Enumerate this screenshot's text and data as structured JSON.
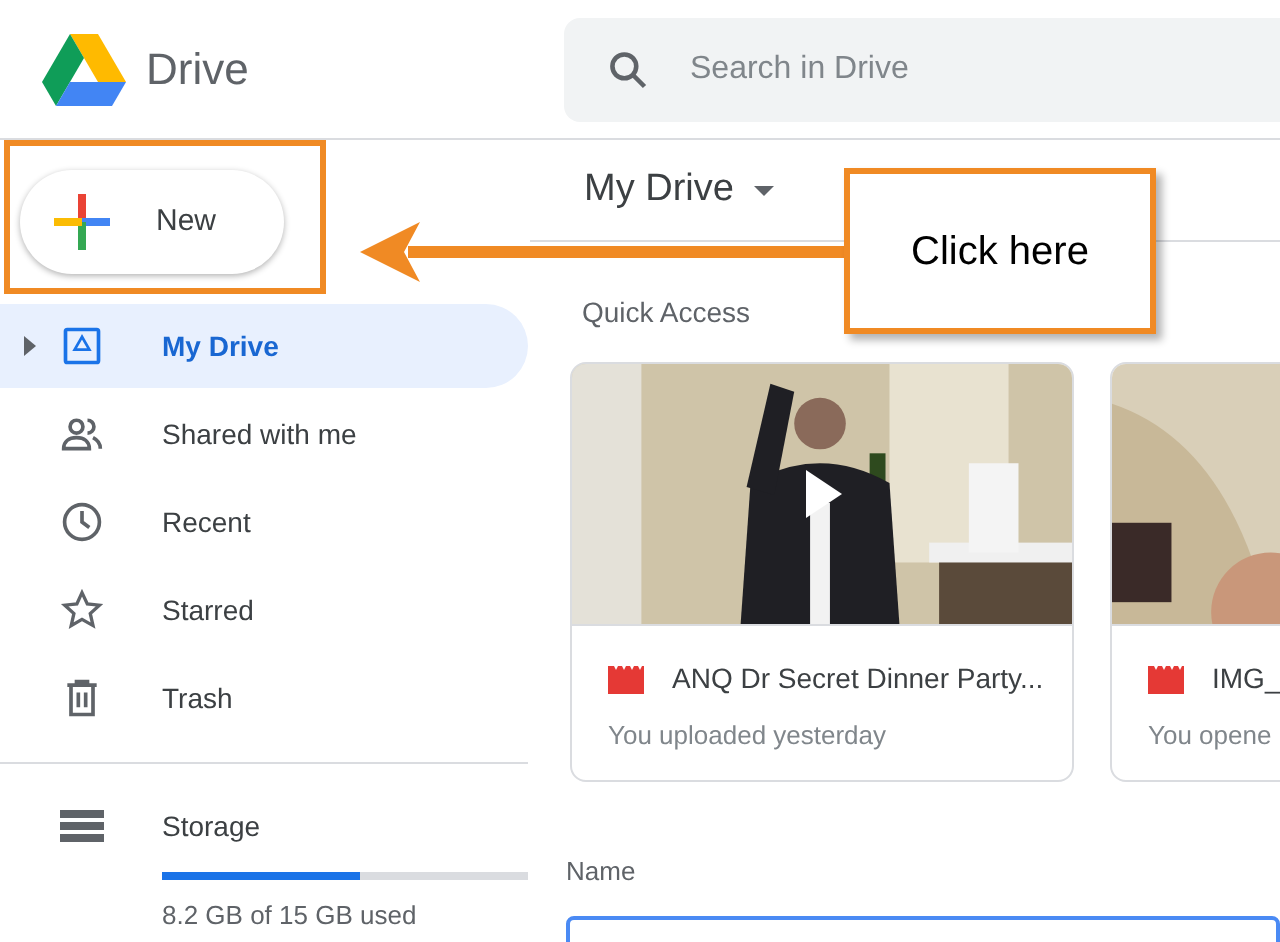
{
  "app": {
    "name": "Drive"
  },
  "search": {
    "placeholder": "Search in Drive"
  },
  "new_button": {
    "label": "New"
  },
  "sidebar": {
    "items": [
      {
        "label": "My Drive",
        "selected": true
      },
      {
        "label": "Shared with me",
        "selected": false
      },
      {
        "label": "Recent",
        "selected": false
      },
      {
        "label": "Starred",
        "selected": false
      },
      {
        "label": "Trash",
        "selected": false
      }
    ]
  },
  "storage": {
    "label": "Storage",
    "level": 0.54,
    "usage": "8.2 GB of 15 GB used"
  },
  "main": {
    "title": "My Drive",
    "section": "Quick Access",
    "files": [
      {
        "name": "ANQ Dr Secret Dinner Party...",
        "activity": "You uploaded yesterday"
      },
      {
        "name": "IMG_",
        "activity": "You opene"
      }
    ],
    "column_header": "Name"
  },
  "annotation": {
    "text": "Click here"
  }
}
